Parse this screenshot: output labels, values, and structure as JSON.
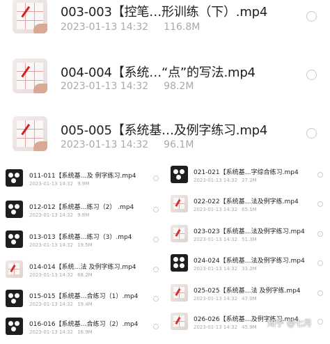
{
  "big_files": [
    {
      "title": "003-003【控笔…形训练（下）.mp4",
      "date": "2023-01-13 14:32",
      "size": "116.8M"
    },
    {
      "title": "004-004【系统…“点”的写法.mp4",
      "date": "2023-01-13 14:32",
      "size": "98.2M"
    },
    {
      "title": "005-005【系统基…及例字练习.mp4",
      "date": "2023-01-13 14:32",
      "size": "96.1M"
    }
  ],
  "left_files": [
    {
      "title": "011-011【系统基…及 例字练习.mp4",
      "date": "2023-01-13 14:32",
      "size": "9.9M",
      "thumb": "dark"
    },
    {
      "title": "012-012【系统基…练习（2） .mp4",
      "date": "2023-01-13 14:32",
      "size": "9.8M",
      "thumb": "dark"
    },
    {
      "title": "013-013【系统基…练习（3）.mp4",
      "date": "2023-01-13 14:32",
      "size": "19.5M",
      "thumb": "dark"
    },
    {
      "title": "014-014【系统…法 及例字练习.mp4",
      "date": "2023-01-13 14:32",
      "size": "68.2M",
      "thumb": "light"
    },
    {
      "title": "015-015【系统基…合练习（1）.mp4",
      "date": "2023-01-13 14:32",
      "size": "19.4M",
      "thumb": "dark"
    },
    {
      "title": "016-016【系统基…合练习（2）.mp4",
      "date": "2023-01-13 14:32",
      "size": "16.9M",
      "thumb": "dark"
    }
  ],
  "right_files": [
    {
      "title": "021-021【系统基…字综合练习.mp4",
      "date": "2023-01-13 14:32",
      "size": "27.2M",
      "thumb": "dark"
    },
    {
      "title": "022-022【系统基…法及例字练.mp4",
      "date": "2023-01-13 14:32",
      "size": "65.1M",
      "thumb": "light"
    },
    {
      "title": "023-023【系统基…法及例字练习.mp4",
      "date": "2023-01-13 14:32",
      "size": "51.3M",
      "thumb": "light"
    },
    {
      "title": "024-024【系统基…法及例字练习.mp4",
      "date": "2023-01-13 14:32",
      "size": "33.2M",
      "thumb": "dark"
    },
    {
      "title": "025-025【系统基…法 及例字练.mp4",
      "date": "2023-01-13 14:32",
      "size": "47.0M",
      "thumb": "light"
    },
    {
      "title": "026-026【系统基…及例字练习.mp4",
      "date": "2023-01-13 14:32",
      "size": "45.9M",
      "thumb": "light"
    }
  ],
  "watermark": "知乎 @七月"
}
